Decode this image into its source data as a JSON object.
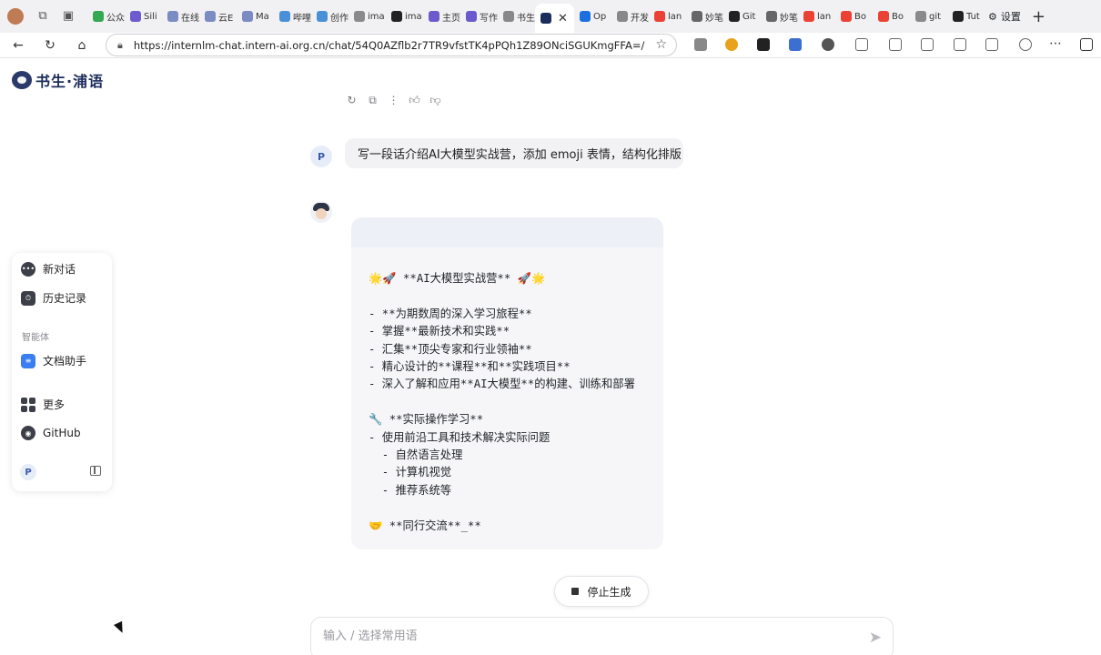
{
  "browser": {
    "tabs": [
      {
        "label": "公众",
        "color": "#34a853"
      },
      {
        "label": "Sili",
        "color": "#6d5bd0"
      },
      {
        "label": "在线",
        "color": "#7a8cc2"
      },
      {
        "label": "云E",
        "color": "#7a8cc2"
      },
      {
        "label": "Ma",
        "color": "#7a8cc2"
      },
      {
        "label": "哔哩",
        "color": "#4a90d9"
      },
      {
        "label": "创作",
        "color": "#4a90d9"
      },
      {
        "label": "ima",
        "color": "#8a8a8a"
      },
      {
        "label": "ima",
        "color": "#222222"
      },
      {
        "label": "主页",
        "color": "#6a5acd"
      },
      {
        "label": "写作",
        "color": "#6a5acd"
      },
      {
        "label": "书生",
        "color": "#888888"
      }
    ],
    "active_tab_color": "#1c2c5c",
    "tabs_after": [
      {
        "label": "Op",
        "color": "#1d6fe0"
      },
      {
        "label": "开发",
        "color": "#888888"
      },
      {
        "label": "lan",
        "color": "#ea4335"
      },
      {
        "label": "妙笔",
        "color": "#666666"
      },
      {
        "label": "Git",
        "color": "#222222"
      },
      {
        "label": "妙笔",
        "color": "#666666"
      },
      {
        "label": "lan",
        "color": "#ea4335"
      },
      {
        "label": "Bo",
        "color": "#ea4335"
      },
      {
        "label": "Bo",
        "color": "#ea4335"
      },
      {
        "label": "git",
        "color": "#8a8a8a"
      },
      {
        "label": "Tut",
        "color": "#222222"
      }
    ],
    "settings_tab": "设置",
    "url": "https://internlm-chat.intern-ai.org.cn/chat/54Q0AZflb2r7TR9vfstTK4pPQh1Z89ONciSGUKmgFFA=/"
  },
  "app": {
    "logo_text": "书生·浦语"
  },
  "sidebar": {
    "new_chat": "新对话",
    "history": "历史记录",
    "section_agents": "智能体",
    "doc_assistant": "文档助手",
    "more": "更多",
    "github": "GitHub",
    "user_initial": "P"
  },
  "chat": {
    "user_initial": "P",
    "user_message": "写一段话介绍AI大模型实战营，添加 emoji 表情，结构化排版",
    "bot_response": "🌟🚀 **AI大模型实战营** 🚀🌟\n\n- **为期数周的深入学习旅程**\n- 掌握**最新技术和实践**\n- 汇集**顶尖专家和行业领袖**\n- 精心设计的**课程**和**实践项目**\n- 深入了解和应用**AI大模型**的构建、训练和部署\n\n🔧 **实际操作学习**\n- 使用前沿工具和技术解决实际问题\n  - 自然语言处理\n  - 计算机视觉\n  - 推荐系统等\n\n🤝 **同行交流**_**",
    "stop_button": "停止生成",
    "input_placeholder": "输入 / 选择常用语"
  }
}
